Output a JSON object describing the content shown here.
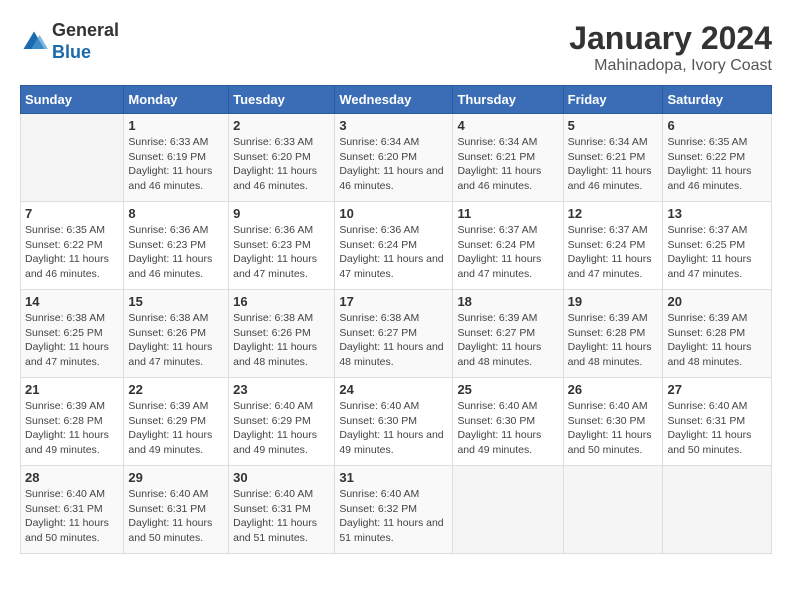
{
  "logo": {
    "text_general": "General",
    "text_blue": "Blue"
  },
  "title": "January 2024",
  "subtitle": "Mahinadopa, Ivory Coast",
  "days_of_week": [
    "Sunday",
    "Monday",
    "Tuesday",
    "Wednesday",
    "Thursday",
    "Friday",
    "Saturday"
  ],
  "weeks": [
    [
      {
        "day": "",
        "sunrise": "",
        "sunset": "",
        "daylight": ""
      },
      {
        "day": "1",
        "sunrise": "Sunrise: 6:33 AM",
        "sunset": "Sunset: 6:19 PM",
        "daylight": "Daylight: 11 hours and 46 minutes."
      },
      {
        "day": "2",
        "sunrise": "Sunrise: 6:33 AM",
        "sunset": "Sunset: 6:20 PM",
        "daylight": "Daylight: 11 hours and 46 minutes."
      },
      {
        "day": "3",
        "sunrise": "Sunrise: 6:34 AM",
        "sunset": "Sunset: 6:20 PM",
        "daylight": "Daylight: 11 hours and 46 minutes."
      },
      {
        "day": "4",
        "sunrise": "Sunrise: 6:34 AM",
        "sunset": "Sunset: 6:21 PM",
        "daylight": "Daylight: 11 hours and 46 minutes."
      },
      {
        "day": "5",
        "sunrise": "Sunrise: 6:34 AM",
        "sunset": "Sunset: 6:21 PM",
        "daylight": "Daylight: 11 hours and 46 minutes."
      },
      {
        "day": "6",
        "sunrise": "Sunrise: 6:35 AM",
        "sunset": "Sunset: 6:22 PM",
        "daylight": "Daylight: 11 hours and 46 minutes."
      }
    ],
    [
      {
        "day": "7",
        "sunrise": "Sunrise: 6:35 AM",
        "sunset": "Sunset: 6:22 PM",
        "daylight": "Daylight: 11 hours and 46 minutes."
      },
      {
        "day": "8",
        "sunrise": "Sunrise: 6:36 AM",
        "sunset": "Sunset: 6:23 PM",
        "daylight": "Daylight: 11 hours and 46 minutes."
      },
      {
        "day": "9",
        "sunrise": "Sunrise: 6:36 AM",
        "sunset": "Sunset: 6:23 PM",
        "daylight": "Daylight: 11 hours and 47 minutes."
      },
      {
        "day": "10",
        "sunrise": "Sunrise: 6:36 AM",
        "sunset": "Sunset: 6:24 PM",
        "daylight": "Daylight: 11 hours and 47 minutes."
      },
      {
        "day": "11",
        "sunrise": "Sunrise: 6:37 AM",
        "sunset": "Sunset: 6:24 PM",
        "daylight": "Daylight: 11 hours and 47 minutes."
      },
      {
        "day": "12",
        "sunrise": "Sunrise: 6:37 AM",
        "sunset": "Sunset: 6:24 PM",
        "daylight": "Daylight: 11 hours and 47 minutes."
      },
      {
        "day": "13",
        "sunrise": "Sunrise: 6:37 AM",
        "sunset": "Sunset: 6:25 PM",
        "daylight": "Daylight: 11 hours and 47 minutes."
      }
    ],
    [
      {
        "day": "14",
        "sunrise": "Sunrise: 6:38 AM",
        "sunset": "Sunset: 6:25 PM",
        "daylight": "Daylight: 11 hours and 47 minutes."
      },
      {
        "day": "15",
        "sunrise": "Sunrise: 6:38 AM",
        "sunset": "Sunset: 6:26 PM",
        "daylight": "Daylight: 11 hours and 47 minutes."
      },
      {
        "day": "16",
        "sunrise": "Sunrise: 6:38 AM",
        "sunset": "Sunset: 6:26 PM",
        "daylight": "Daylight: 11 hours and 48 minutes."
      },
      {
        "day": "17",
        "sunrise": "Sunrise: 6:38 AM",
        "sunset": "Sunset: 6:27 PM",
        "daylight": "Daylight: 11 hours and 48 minutes."
      },
      {
        "day": "18",
        "sunrise": "Sunrise: 6:39 AM",
        "sunset": "Sunset: 6:27 PM",
        "daylight": "Daylight: 11 hours and 48 minutes."
      },
      {
        "day": "19",
        "sunrise": "Sunrise: 6:39 AM",
        "sunset": "Sunset: 6:28 PM",
        "daylight": "Daylight: 11 hours and 48 minutes."
      },
      {
        "day": "20",
        "sunrise": "Sunrise: 6:39 AM",
        "sunset": "Sunset: 6:28 PM",
        "daylight": "Daylight: 11 hours and 48 minutes."
      }
    ],
    [
      {
        "day": "21",
        "sunrise": "Sunrise: 6:39 AM",
        "sunset": "Sunset: 6:28 PM",
        "daylight": "Daylight: 11 hours and 49 minutes."
      },
      {
        "day": "22",
        "sunrise": "Sunrise: 6:39 AM",
        "sunset": "Sunset: 6:29 PM",
        "daylight": "Daylight: 11 hours and 49 minutes."
      },
      {
        "day": "23",
        "sunrise": "Sunrise: 6:40 AM",
        "sunset": "Sunset: 6:29 PM",
        "daylight": "Daylight: 11 hours and 49 minutes."
      },
      {
        "day": "24",
        "sunrise": "Sunrise: 6:40 AM",
        "sunset": "Sunset: 6:30 PM",
        "daylight": "Daylight: 11 hours and 49 minutes."
      },
      {
        "day": "25",
        "sunrise": "Sunrise: 6:40 AM",
        "sunset": "Sunset: 6:30 PM",
        "daylight": "Daylight: 11 hours and 49 minutes."
      },
      {
        "day": "26",
        "sunrise": "Sunrise: 6:40 AM",
        "sunset": "Sunset: 6:30 PM",
        "daylight": "Daylight: 11 hours and 50 minutes."
      },
      {
        "day": "27",
        "sunrise": "Sunrise: 6:40 AM",
        "sunset": "Sunset: 6:31 PM",
        "daylight": "Daylight: 11 hours and 50 minutes."
      }
    ],
    [
      {
        "day": "28",
        "sunrise": "Sunrise: 6:40 AM",
        "sunset": "Sunset: 6:31 PM",
        "daylight": "Daylight: 11 hours and 50 minutes."
      },
      {
        "day": "29",
        "sunrise": "Sunrise: 6:40 AM",
        "sunset": "Sunset: 6:31 PM",
        "daylight": "Daylight: 11 hours and 50 minutes."
      },
      {
        "day": "30",
        "sunrise": "Sunrise: 6:40 AM",
        "sunset": "Sunset: 6:31 PM",
        "daylight": "Daylight: 11 hours and 51 minutes."
      },
      {
        "day": "31",
        "sunrise": "Sunrise: 6:40 AM",
        "sunset": "Sunset: 6:32 PM",
        "daylight": "Daylight: 11 hours and 51 minutes."
      },
      {
        "day": "",
        "sunrise": "",
        "sunset": "",
        "daylight": ""
      },
      {
        "day": "",
        "sunrise": "",
        "sunset": "",
        "daylight": ""
      },
      {
        "day": "",
        "sunrise": "",
        "sunset": "",
        "daylight": ""
      }
    ]
  ]
}
